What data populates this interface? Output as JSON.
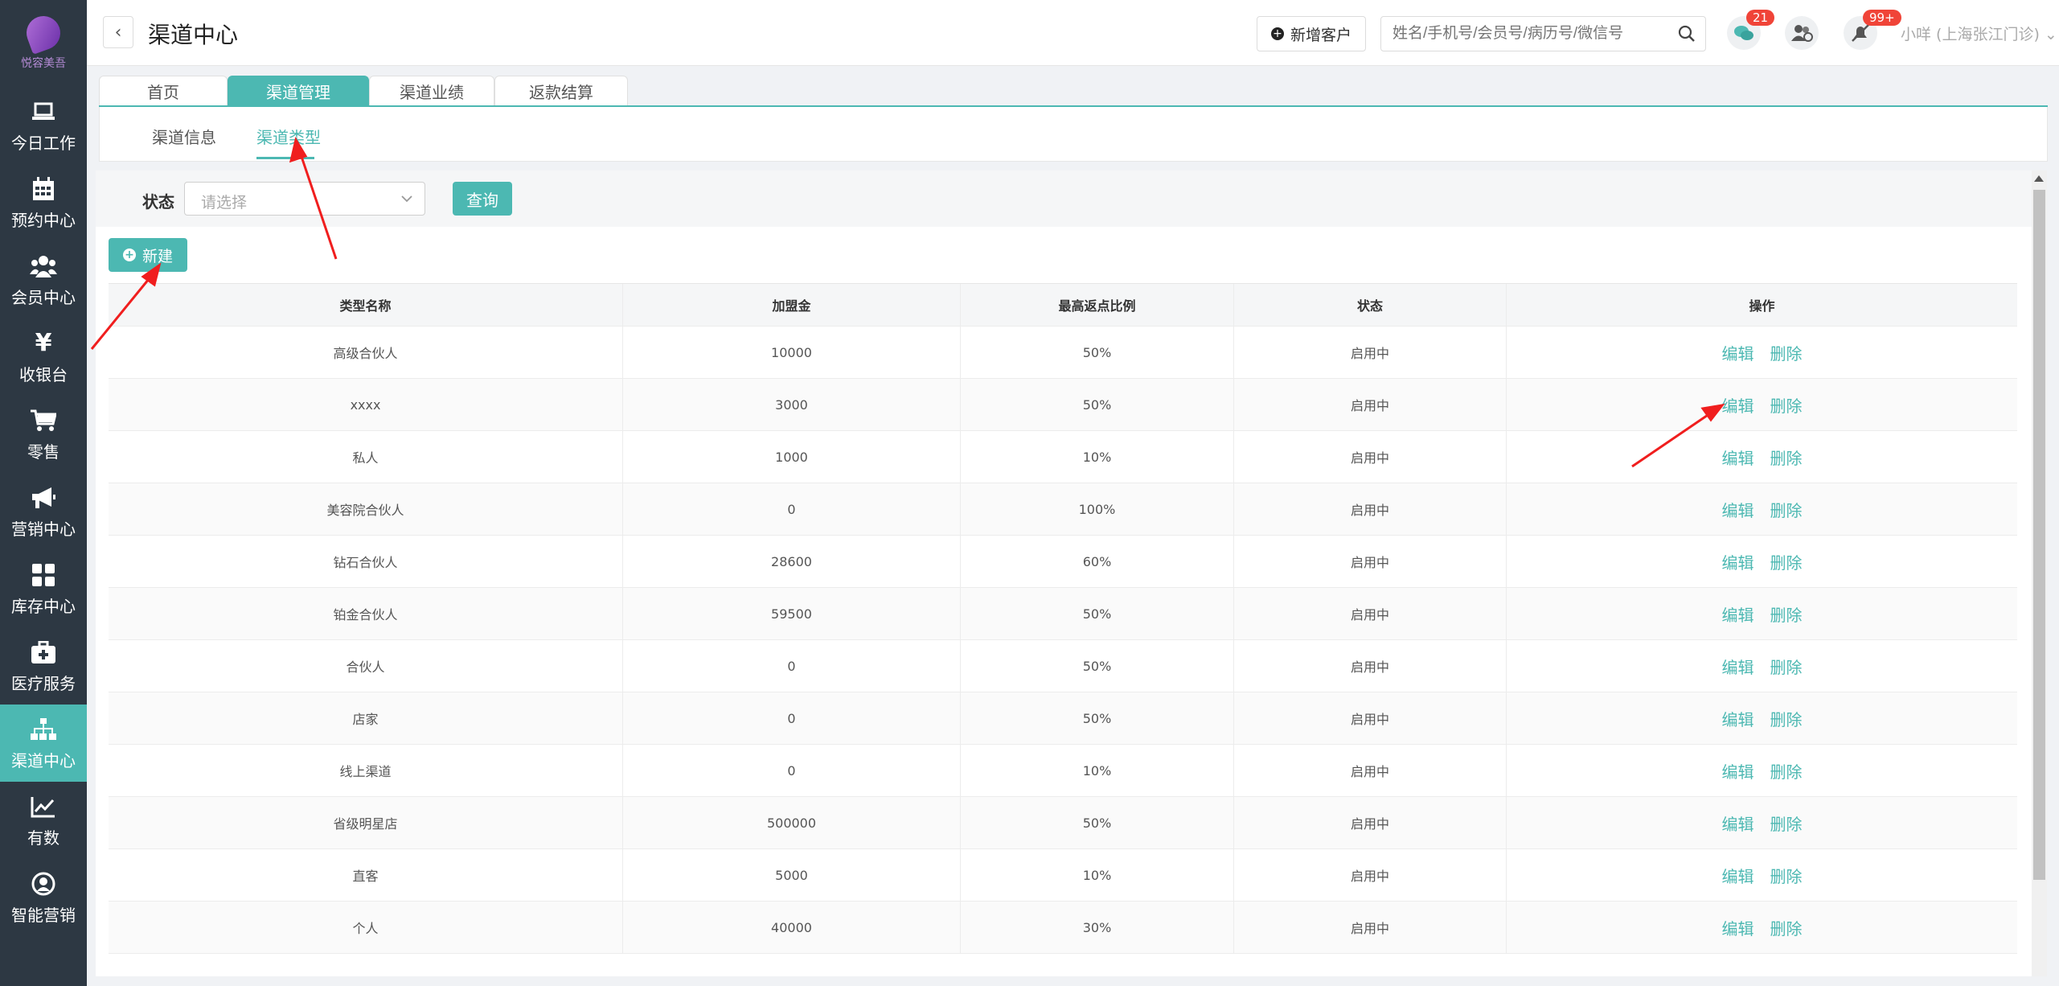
{
  "brand": {
    "logo_text": "悦容美吾",
    "accent": "#4cb8b2",
    "sidebar_bg": "#2d3843"
  },
  "sidebar": {
    "items": [
      {
        "label": "今日工作",
        "icon": "laptop-icon"
      },
      {
        "label": "预约中心",
        "icon": "calendar-icon"
      },
      {
        "label": "会员中心",
        "icon": "users-icon"
      },
      {
        "label": "收银台",
        "icon": "yen-icon"
      },
      {
        "label": "零售",
        "icon": "cart-icon"
      },
      {
        "label": "营销中心",
        "icon": "megaphone-icon"
      },
      {
        "label": "库存中心",
        "icon": "grid-icon"
      },
      {
        "label": "医疗服务",
        "icon": "medkit-icon"
      },
      {
        "label": "渠道中心",
        "icon": "sitemap-icon",
        "active": true
      },
      {
        "label": "有数",
        "icon": "chart-line-icon"
      },
      {
        "label": "智能营销",
        "icon": "robot-icon"
      }
    ]
  },
  "header": {
    "title": "渠道中心",
    "new_customer_label": "新增客户",
    "search_placeholder": "姓名/手机号/会员号/病历号/微信号",
    "wechat_badge": "21",
    "notify_badge": "99+",
    "user": "小咩 (上海张江门诊)"
  },
  "tabs": [
    "首页",
    "渠道管理",
    "渠道业绩",
    "返款结算"
  ],
  "subnav": [
    "渠道信息",
    "渠道类型"
  ],
  "filter": {
    "status_label": "状态",
    "status_placeholder": "请选择",
    "query_label": "查询"
  },
  "new_label": "新建",
  "table": {
    "headers": [
      "类型名称",
      "加盟金",
      "最高返点比例",
      "状态",
      "操作"
    ],
    "edit_label": "编辑",
    "delete_label": "删除",
    "rows": [
      [
        "高级合伙人",
        "10000",
        "50%",
        "启用中"
      ],
      [
        "xxxx",
        "3000",
        "50%",
        "启用中"
      ],
      [
        "私人",
        "1000",
        "10%",
        "启用中"
      ],
      [
        "美容院合伙人",
        "0",
        "100%",
        "启用中"
      ],
      [
        "钻石合伙人",
        "28600",
        "60%",
        "启用中"
      ],
      [
        "铂金合伙人",
        "59500",
        "50%",
        "启用中"
      ],
      [
        "合伙人",
        "0",
        "50%",
        "启用中"
      ],
      [
        "店家",
        "0",
        "50%",
        "启用中"
      ],
      [
        "线上渠道",
        "0",
        "10%",
        "启用中"
      ],
      [
        "省级明星店",
        "500000",
        "50%",
        "启用中"
      ],
      [
        "直客",
        "5000",
        "10%",
        "启用中"
      ],
      [
        "个人",
        "40000",
        "30%",
        "启用中"
      ]
    ]
  }
}
